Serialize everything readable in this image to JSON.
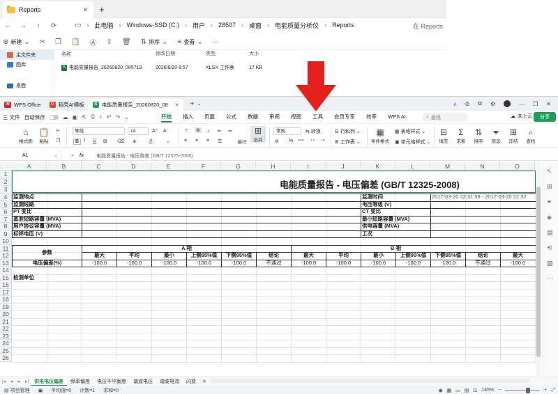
{
  "explorer": {
    "tab_title": "Reports",
    "tab_close": "✕",
    "new_tab": "+",
    "breadcrumb": [
      "此电脑",
      "Windows-SSD (C:)",
      "用户",
      "28507",
      "桌面",
      "电能质量分析仪",
      "Reports"
    ],
    "search_placeholder": "在 Reports",
    "commands": {
      "new": "新建",
      "sort": "排序",
      "view": "查看",
      "more": "···"
    },
    "nav": [
      "主文件夹",
      "图库",
      "桌面"
    ],
    "columns": [
      "名称",
      "修改日期",
      "类型",
      "大小"
    ],
    "file": {
      "name": "电能质量报告_20260820_085719",
      "date": "2026/8/20 8:57",
      "type": "XLSX 工作表",
      "size": "17 KB"
    }
  },
  "wps": {
    "tabs": [
      {
        "label": "WPS Office",
        "icon": "wps-logo-icon"
      },
      {
        "label": "稻壳AI模板",
        "icon": "docer-icon"
      },
      {
        "label": "电能质量报告_20260820_08",
        "icon": "sheet-icon"
      }
    ],
    "tab_close": "✕",
    "new_tab": "+",
    "menu": {
      "file": "三 文件",
      "autosave": "自动保存"
    },
    "ribbon_tabs": [
      "开始",
      "插入",
      "页面",
      "公式",
      "数据",
      "审阅",
      "视图",
      "工具",
      "会员专享",
      "效率",
      "WPS AI"
    ],
    "active_ribbon_tab": "开始",
    "search": "查找",
    "cloud": "未上云",
    "share": "分享",
    "ribbon": {
      "format_painter": "格式刷",
      "paste": "粘贴",
      "font": "等线",
      "font_size": "14",
      "wrap": "换行",
      "merge": "合并",
      "number_format": "常规",
      "convert": "转换",
      "row_col": "行和列",
      "worksheet": "工作表",
      "cond_format": "条件格式",
      "table_style": "表格样式",
      "cell_style": "单元格样式",
      "fill": "填充",
      "sum": "求和",
      "sort": "排序",
      "filter": "筛选",
      "freeze": "冻结",
      "find": "查找"
    },
    "name_box": "A1",
    "formula": "电能质量报告 - 电压偏差 (GB/T 12325-2008)",
    "columns": [
      "A",
      "B",
      "C",
      "D",
      "E",
      "F",
      "G",
      "H",
      "I",
      "J",
      "K",
      "L",
      "M",
      "N",
      "O"
    ],
    "rows": [
      "1",
      "2",
      "3",
      "4",
      "5",
      "6",
      "7",
      "8",
      "9",
      "10",
      "11",
      "12",
      "13",
      "14",
      "15",
      "16",
      "17",
      "18",
      "19",
      "20",
      "21",
      "22",
      "23",
      "24",
      "25",
      "26"
    ],
    "sheet": {
      "title": "电能质量报告 - 电压偏差 (GB/T 12325-2008)",
      "left_labels": [
        "监测地点",
        "监测线路",
        "PT 变比",
        "基准短路容量 (MVA)",
        "用户协议容量 (MVA)",
        "标称电压 (V)"
      ],
      "right_labels": [
        "监测时间",
        "电压等级 (V)",
        "CT 变比",
        "最小短路容量 (MVA)",
        "供电容量 (MVA)",
        "工况"
      ],
      "monitor_time": "2017-03-20 22:31:59 - 2017-03-20 22:32",
      "param_label": "参数",
      "phase_a": "A 相",
      "phase_b": "B 相",
      "stat_headers": [
        "最大",
        "平均",
        "最小",
        "上侧95%值",
        "下侧95%值",
        "结论"
      ],
      "row13_label": "电压偏差(%)",
      "a_values": [
        "-100.0",
        "-100.0",
        "-100.0",
        "-100.0",
        "-100.0",
        "不通过"
      ],
      "b_values": [
        "-100.0",
        "-100.0",
        "-100.0",
        "-100.0",
        "-100.0",
        "不通过"
      ],
      "o13_value": "-100.0",
      "o12_header": "最大",
      "org_label": "检测单位"
    },
    "sheet_tabs": [
      "供电电压偏差",
      "频率偏差",
      "电压不平衡度",
      "谐波电压",
      "谐波电流",
      "闪变"
    ],
    "active_sheet": "供电电压偏差",
    "status": {
      "project": "项目管理",
      "avg": "平均值=0",
      "count": "计数=1",
      "sum": "求和=0",
      "zoom": "145%"
    }
  },
  "colors": {
    "wps_green": "#1e8e4e",
    "arrow_red": "#e3201b",
    "excel_green": "#1d7a3d"
  }
}
